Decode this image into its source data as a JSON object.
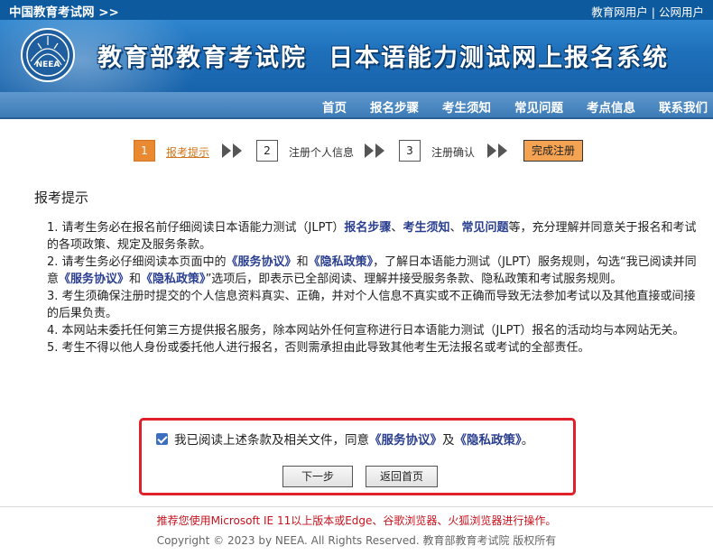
{
  "topbar": {
    "site_link": "中国教育考试网 >>",
    "user_links": [
      "教育网用户",
      "公网用户"
    ],
    "separator": "|"
  },
  "banner": {
    "org_name": "教育部教育考试院",
    "system_name": "日本语能力测试网上报名系统",
    "logo_text": "NEEA"
  },
  "nav": {
    "items": [
      "首页",
      "报名步骤",
      "考生须知",
      "常见问题",
      "考点信息",
      "联系我们"
    ]
  },
  "steps": {
    "items": [
      {
        "number": "1",
        "label": "报考提示"
      },
      {
        "number": "2",
        "label": "注册个人信息"
      },
      {
        "number": "3",
        "label": "注册确认"
      }
    ],
    "finish_label": "完成注册"
  },
  "section_title": "报考提示",
  "terms": [
    {
      "parts": [
        "1. 请考生务必在报名前仔细阅读日本语能力测试（JLPT）",
        "报名步骤",
        "、",
        "考生须知",
        "、",
        "常见问题",
        "等，充分理解并同意关于报名和考试的各项政策、规定及服务条款。"
      ]
    },
    {
      "parts": [
        "2. 请考生务必仔细阅读本页面中的",
        "《服务协议》",
        "和",
        "《隐私政策》",
        "，了解日本语能力测试（JLPT）服务规则，勾选“我已阅读并同意",
        "《服务协议》",
        "和",
        "《隐私政策》",
        "”选项后，即表示已全部阅读、理解并接受服务条款、隐私政策和考试服务规则。"
      ]
    },
    {
      "parts": [
        "3. 考生须确保注册时提交的个人信息资料真实、正确，并对个人信息不真实或不正确而导致无法参加考试以及其他直接或间接的后果负责。"
      ]
    },
    {
      "parts": [
        "4. 本网站未委托任何第三方提供报名服务，除本网站外任何宣称进行日本语能力测试（JLPT）报名的活动均与本网站无关。"
      ]
    },
    {
      "parts": [
        "5. 考生不得以他人身份或委托他人进行报名，否则需承担由此导致其他考生无法报名或考试的全部责任。"
      ]
    }
  ],
  "agreement": {
    "checked": true,
    "text_before": "我已阅读上述条款及相关文件，同意",
    "service_link": "《服务协议》",
    "text_mid": "及",
    "privacy_link": "《隐私政策》",
    "text_after": "。",
    "next_label": "下一步",
    "home_label": "返回首页"
  },
  "footer": {
    "warning": "推荐您使用Microsoft IE 11以上版本或Edge、谷歌浏览器、火狐浏览器进行操作。",
    "copyright": "Copyright © 2023 by NEEA. All Rights Reserved. 教育部教育考试院 版权所有"
  },
  "colors": {
    "topbar": "#0e5a9e",
    "banner": "#1e6fba",
    "nav": "#3d7bb7",
    "accent_orange": "#e98a32",
    "highlight_text": "#2a3f8f",
    "warning_red": "#c8121c",
    "box_border": "#e0202a"
  }
}
